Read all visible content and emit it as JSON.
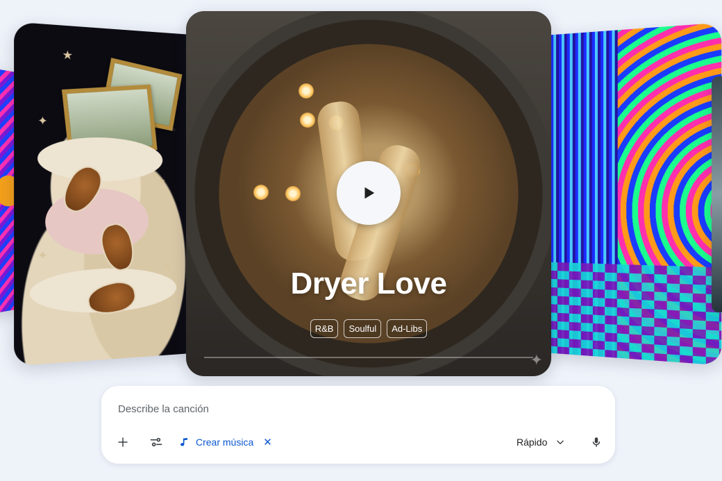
{
  "carousel": {
    "featured": {
      "title": "Dryer Love",
      "tags": [
        "R&B",
        "Soulful",
        "Ad-Libs"
      ]
    }
  },
  "composer": {
    "placeholder": "Describe la canción",
    "chip_label": "Crear música",
    "mode_label": "Rápido"
  },
  "icons": {
    "add": "plus-icon",
    "tools": "tune-icon",
    "music": "music-note-icon",
    "close": "close-icon",
    "dropdown": "chevron-down-icon",
    "mic": "microphone-icon",
    "play": "play-icon"
  },
  "colors": {
    "background": "#eef2f9",
    "accent": "#0b57d0"
  }
}
